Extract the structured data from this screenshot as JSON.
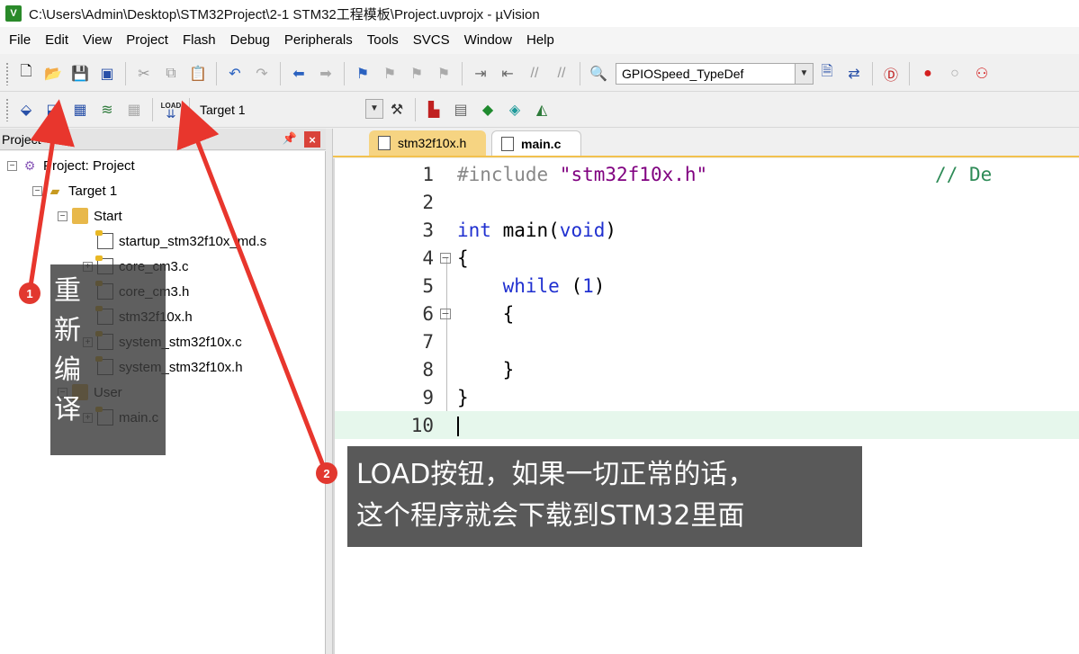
{
  "window": {
    "title": "C:\\Users\\Admin\\Desktop\\STM32Project\\2-1 STM32工程模板\\Project.uvprojx - µVision",
    "logo": "V"
  },
  "menu": [
    "File",
    "Edit",
    "View",
    "Project",
    "Flash",
    "Debug",
    "Peripherals",
    "Tools",
    "SVCS",
    "Window",
    "Help"
  ],
  "toolbar1": {
    "icons": [
      "new-file-icon",
      "open-icon",
      "save-icon",
      "save-all-icon",
      "cut-icon",
      "copy-icon",
      "paste-icon",
      "undo-icon",
      "redo-icon",
      "nav-back-icon",
      "nav-forward-icon",
      "bookmark-icon",
      "bookmark-prev-icon",
      "bookmark-next-icon",
      "bookmark-clear-icon",
      "indent-icon",
      "unindent-icon",
      "comment-icon",
      "uncomment-icon",
      "find-in-files-icon"
    ],
    "search_value": "GPIOSpeed_TypeDef",
    "tail_icons": [
      "incremental-find-icon",
      "source-browser-icon",
      "debug-start-icon",
      "breakpoint-icon",
      "breakpoint-disable-icon",
      "breakpoint-kill-icon"
    ]
  },
  "toolbar2": {
    "icons": [
      "translate-icon",
      "build-icon",
      "rebuild-icon",
      "batch-build-icon",
      "stop-build-icon"
    ],
    "load_icon": "load-icon",
    "load_label": "LOAD",
    "target_value": "Target 1",
    "tail_icons": [
      "target-options-icon",
      "manage-components-icon",
      "select-pack-icon",
      "pack-installer-icon",
      "run-time-env-icon"
    ]
  },
  "project_panel": {
    "title": "Project",
    "tree": [
      {
        "label": "Project: Project",
        "level": 0,
        "expander": "⊟",
        "type": "project"
      },
      {
        "label": "Target 1",
        "level": 1,
        "expander": "⊟",
        "type": "target"
      },
      {
        "label": "Start",
        "level": 2,
        "expander": "⊟",
        "type": "folder"
      },
      {
        "label": "startup_stm32f10x_md.s",
        "level": 3,
        "expander": "",
        "type": "file"
      },
      {
        "label": "core_cm3.c",
        "level": 3,
        "expander": "⊞",
        "type": "file"
      },
      {
        "label": "core_cm3.h",
        "level": 3,
        "expander": "",
        "type": "file"
      },
      {
        "label": "stm32f10x.h",
        "level": 3,
        "expander": "",
        "type": "file"
      },
      {
        "label": "system_stm32f10x.c",
        "level": 3,
        "expander": "⊞",
        "type": "file"
      },
      {
        "label": "system_stm32f10x.h",
        "level": 3,
        "expander": "",
        "type": "file"
      },
      {
        "label": "User",
        "level": 2,
        "expander": "⊟",
        "type": "folder"
      },
      {
        "label": "main.c",
        "level": 3,
        "expander": "⊞",
        "type": "file"
      }
    ]
  },
  "tabs": [
    {
      "label": "stm32f10x.h",
      "active": false
    },
    {
      "label": "main.c",
      "active": true
    }
  ],
  "code": [
    {
      "n": "1",
      "fold": "",
      "tokens": [
        [
          "pp",
          "#include "
        ],
        [
          "str",
          "\"stm32f10x.h\""
        ],
        [
          "plain",
          "                    "
        ],
        [
          "cm",
          "// De"
        ]
      ]
    },
    {
      "n": "2",
      "fold": "",
      "tokens": []
    },
    {
      "n": "3",
      "fold": "",
      "tokens": [
        [
          "kw",
          "int"
        ],
        [
          "plain",
          " main("
        ],
        [
          "kw",
          "void"
        ],
        [
          "plain",
          ")"
        ]
      ]
    },
    {
      "n": "4",
      "fold": "⊟",
      "tokens": [
        [
          "plain",
          "{"
        ]
      ]
    },
    {
      "n": "5",
      "fold": "",
      "tokens": [
        [
          "plain",
          "    "
        ],
        [
          "kw",
          "while"
        ],
        [
          "plain",
          " ("
        ],
        [
          "kw",
          "1"
        ],
        [
          "plain",
          ")"
        ]
      ]
    },
    {
      "n": "6",
      "fold": "⊟",
      "tokens": [
        [
          "plain",
          "    {"
        ]
      ]
    },
    {
      "n": "7",
      "fold": "",
      "tokens": []
    },
    {
      "n": "8",
      "fold": "",
      "tokens": [
        [
          "plain",
          "    }"
        ]
      ]
    },
    {
      "n": "9",
      "fold": "",
      "tokens": [
        [
          "plain",
          "}"
        ]
      ]
    },
    {
      "n": "10",
      "fold": "",
      "tokens": [],
      "current": true
    }
  ],
  "annotations": {
    "badge1": "1",
    "callout1": "重新编译",
    "badge2": "2",
    "callout2_line1": "LOAD按钮，如果一切正常的话，",
    "callout2_line2": "这个程序就会下载到STM32里面"
  },
  "colors": {
    "arrow": "#e8362d",
    "tab_active_accent": "#f2c14e",
    "current_line": "#e6f7ec"
  }
}
